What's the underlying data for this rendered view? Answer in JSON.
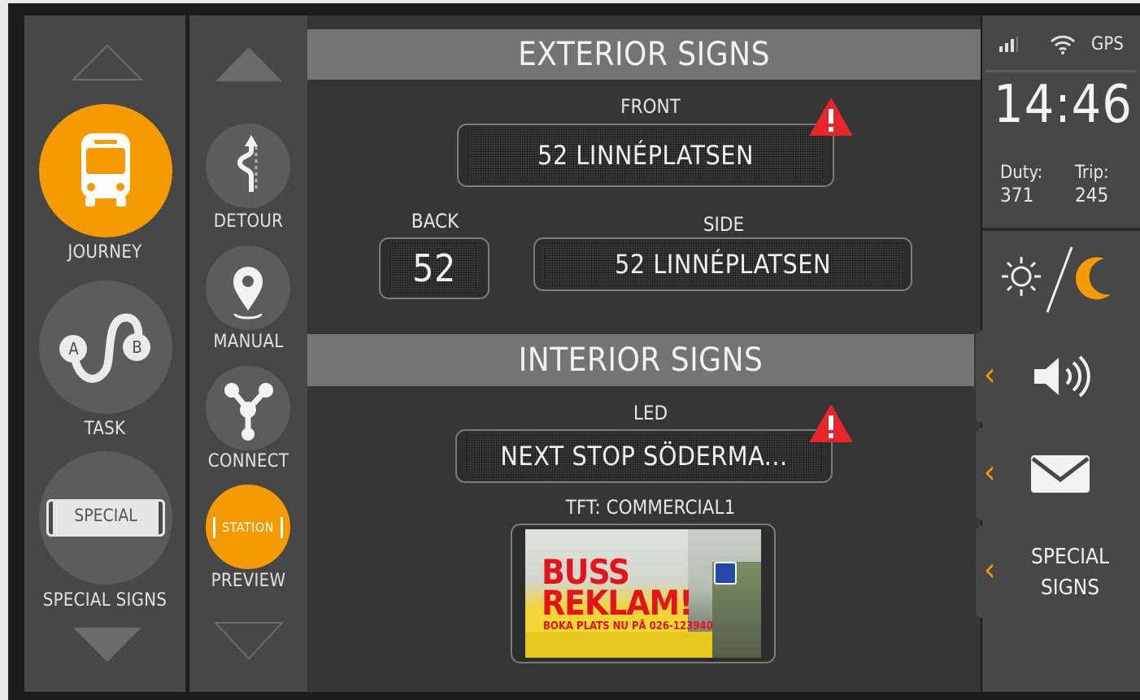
{
  "nav_primary": {
    "journey_label": "JOURNEY",
    "task_label": "TASK",
    "task_point_a": "A",
    "task_point_b": "B",
    "special_signs_label": "SPECIAL SIGNS",
    "special_button_text": "SPECIAL"
  },
  "nav_secondary": {
    "detour_label": "DETOUR",
    "manual_label": "MANUAL",
    "connect_label": "CONNECT",
    "preview_label": "PREVIEW",
    "station_badge": "STATION"
  },
  "exterior": {
    "title": "EXTERIOR SIGNS",
    "front_label": "FRONT",
    "front_text": "52 LINNÉPLATSEN",
    "back_label": "BACK",
    "back_text": "52",
    "side_label": "SIDE",
    "side_text": "52 LINNÉPLATSEN"
  },
  "interior": {
    "title": "INTERIOR SIGNS",
    "led_label": "LED",
    "led_text": "NEXT STOP SÖDERMA...",
    "tft_label": "TFT: COMMERCIAL1",
    "ad_headline_1": "BUSS",
    "ad_headline_2": "REKLAM!",
    "ad_subline": "BOKA PLATS NU PÅ 026-123940"
  },
  "status": {
    "gps_label": "GPS",
    "time": "14:46",
    "duty_label": "Duty:",
    "duty_value": "371",
    "trip_label": "Trip:",
    "trip_value": "245",
    "special_signs_line1": "SPECIAL",
    "special_signs_line2": "SIGNS"
  },
  "colors": {
    "accent": "#f59a00",
    "warning": "#e8262a",
    "panel": "#474747",
    "header_bar": "#747474"
  }
}
